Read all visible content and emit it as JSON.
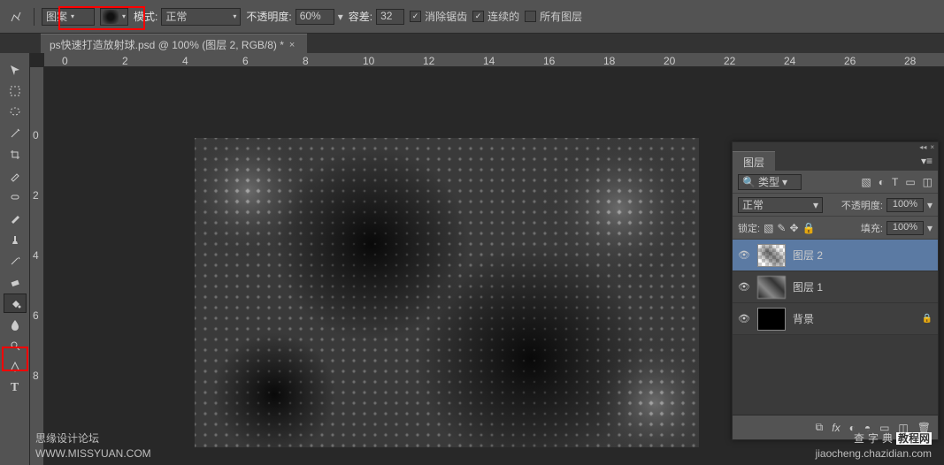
{
  "options_bar": {
    "fill_type_label": "图案",
    "mode_label": "模式:",
    "mode_value": "正常",
    "opacity_label": "不透明度:",
    "opacity_value": "60%",
    "tolerance_label": "容差:",
    "tolerance_value": "32",
    "anti_alias_label": "消除锯齿",
    "anti_alias_checked": true,
    "contiguous_label": "连续的",
    "contiguous_checked": true,
    "all_layers_label": "所有图层",
    "all_layers_checked": false
  },
  "document": {
    "tab_title": "ps快速打造放射球.psd @ 100% (图层 2, RGB/8) *"
  },
  "rulers": {
    "h_ticks": [
      "0",
      "2",
      "4",
      "6",
      "8",
      "10",
      "12",
      "14",
      "16",
      "18",
      "20",
      "22",
      "24",
      "26",
      "28"
    ],
    "v_ticks": [
      "0",
      "2",
      "4",
      "6",
      "8"
    ]
  },
  "layers_panel": {
    "tab_label": "图层",
    "filter_label": "类型",
    "blend_mode": "正常",
    "opacity_label": "不透明度:",
    "opacity_value": "100%",
    "lock_label": "锁定:",
    "fill_label": "填充:",
    "fill_value": "100%",
    "layers": [
      {
        "name": "图层 2",
        "thumb": "checker",
        "locked": false,
        "active": true
      },
      {
        "name": "图层 1",
        "thumb": "cloud",
        "locked": false,
        "active": false
      },
      {
        "name": "背景",
        "thumb": "black",
        "locked": true,
        "active": false
      }
    ],
    "footer_fx": "fx"
  },
  "watermarks": {
    "left_line1": "思缘设计论坛",
    "left_line2": "WWW.MISSYUAN.COM",
    "right_logo": "查字典",
    "right_logo_suffix": "教程网",
    "right_url": "jiaocheng.chazidian.com"
  }
}
